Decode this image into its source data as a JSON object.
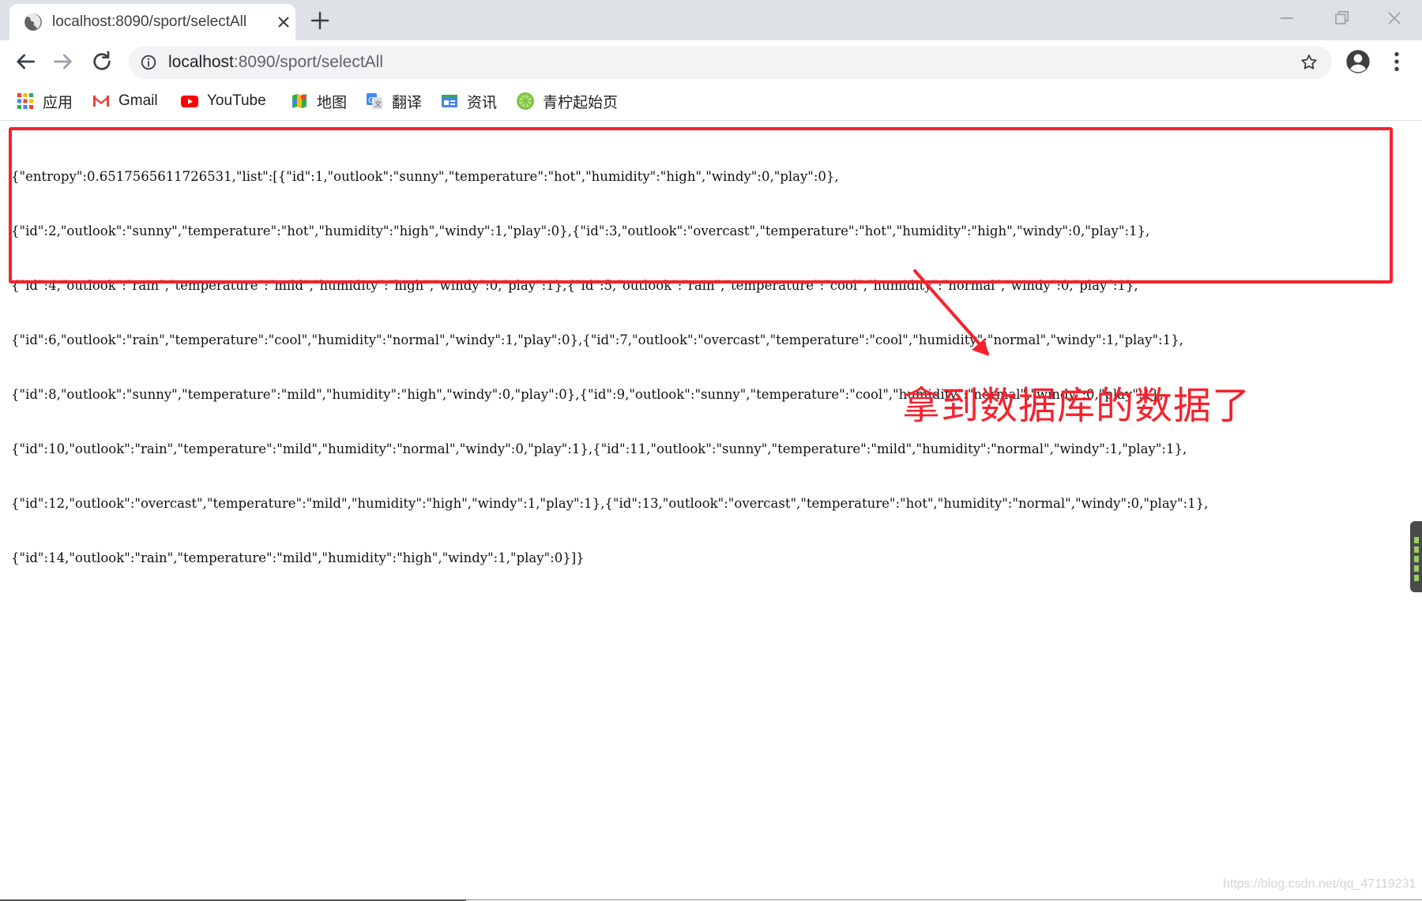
{
  "tab": {
    "title": "localhost:8090/sport/selectAll"
  },
  "omnibox": {
    "url_host": "localhost",
    "url_path": ":8090/sport/selectAll"
  },
  "bookmarks": [
    {
      "label": "应用",
      "icon": "apps-grid-icon"
    },
    {
      "label": "Gmail",
      "icon": "gmail-icon"
    },
    {
      "label": "YouTube",
      "icon": "youtube-icon"
    },
    {
      "label": "地图",
      "icon": "maps-icon"
    },
    {
      "label": "翻译",
      "icon": "translate-icon"
    },
    {
      "label": "资讯",
      "icon": "news-icon"
    },
    {
      "label": "青柠起始页",
      "icon": "lime-icon"
    }
  ],
  "json_lines": [
    "{\"entropy\":0.6517565611726531,\"list\":[{\"id\":1,\"outlook\":\"sunny\",\"temperature\":\"hot\",\"humidity\":\"high\",\"windy\":0,\"play\":0},",
    "{\"id\":2,\"outlook\":\"sunny\",\"temperature\":\"hot\",\"humidity\":\"high\",\"windy\":1,\"play\":0},{\"id\":3,\"outlook\":\"overcast\",\"temperature\":\"hot\",\"humidity\":\"high\",\"windy\":0,\"play\":1},",
    "{\"id\":4,\"outlook\":\"rain\",\"temperature\":\"mild\",\"humidity\":\"high\",\"windy\":0,\"play\":1},{\"id\":5,\"outlook\":\"rain\",\"temperature\":\"cool\",\"humidity\":\"normal\",\"windy\":0,\"play\":1},",
    "{\"id\":6,\"outlook\":\"rain\",\"temperature\":\"cool\",\"humidity\":\"normal\",\"windy\":1,\"play\":0},{\"id\":7,\"outlook\":\"overcast\",\"temperature\":\"cool\",\"humidity\":\"normal\",\"windy\":1,\"play\":1},",
    "{\"id\":8,\"outlook\":\"sunny\",\"temperature\":\"mild\",\"humidity\":\"high\",\"windy\":0,\"play\":0},{\"id\":9,\"outlook\":\"sunny\",\"temperature\":\"cool\",\"humidity\":\"normal\",\"windy\":0,\"play\":1},",
    "{\"id\":10,\"outlook\":\"rain\",\"temperature\":\"mild\",\"humidity\":\"normal\",\"windy\":0,\"play\":1},{\"id\":11,\"outlook\":\"sunny\",\"temperature\":\"mild\",\"humidity\":\"normal\",\"windy\":1,\"play\":1},",
    "{\"id\":12,\"outlook\":\"overcast\",\"temperature\":\"mild\",\"humidity\":\"high\",\"windy\":1,\"play\":1},{\"id\":13,\"outlook\":\"overcast\",\"temperature\":\"hot\",\"humidity\":\"normal\",\"windy\":0,\"play\":1},",
    "{\"id\":14,\"outlook\":\"rain\",\"temperature\":\"mild\",\"humidity\":\"high\",\"windy\":1,\"play\":0}]}"
  ],
  "annotation": {
    "text": "拿到数据库的数据了",
    "color": "#f5222d"
  },
  "watermark": "https://blog.csdn.net/qq_47119231",
  "colors": {
    "tabstrip": "#dee1e6",
    "omnibox": "#f1f3f4",
    "highlight": "#f5222d"
  }
}
